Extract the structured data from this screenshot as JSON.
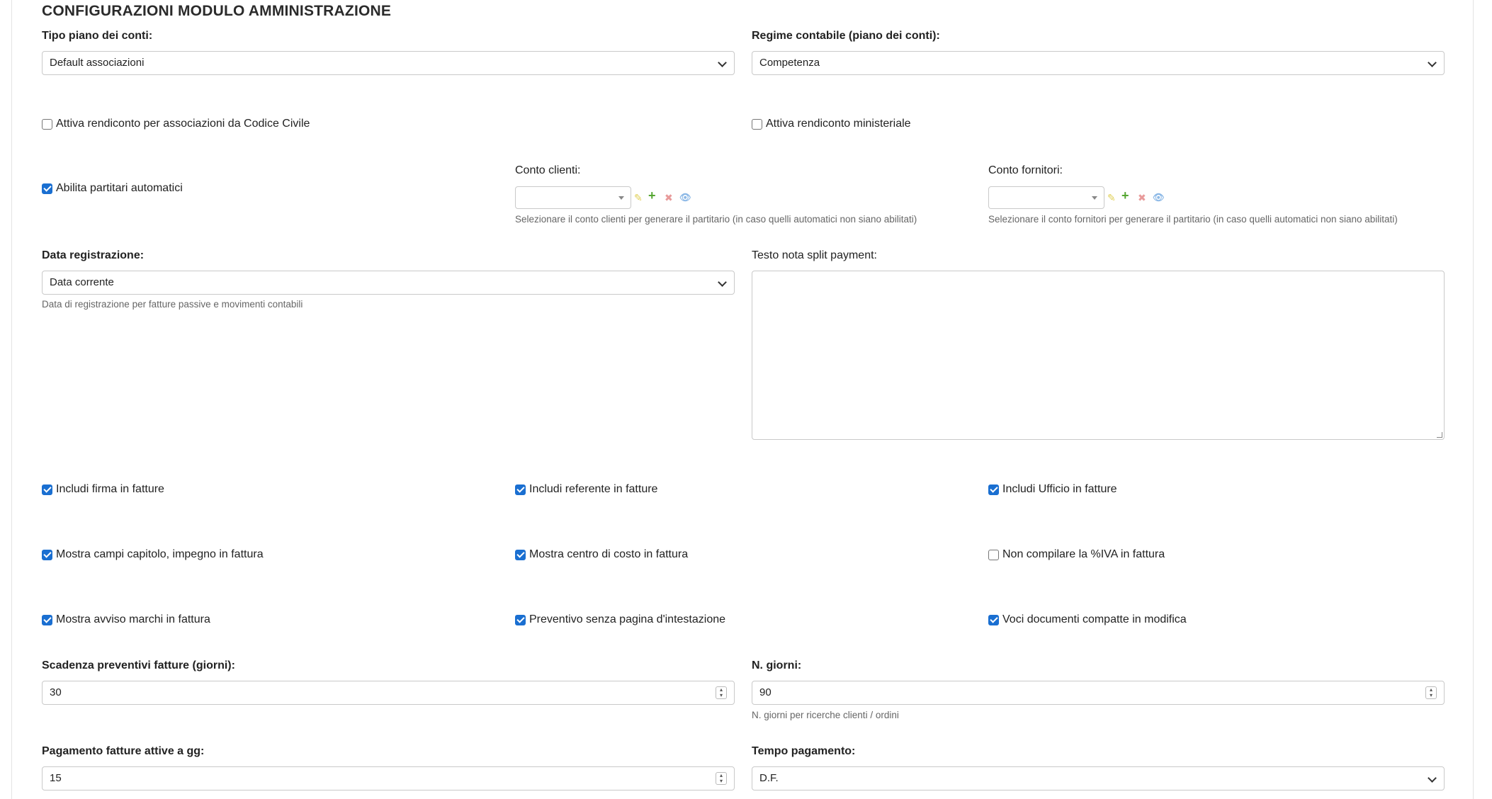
{
  "title": "CONFIGURAZIONI MODULO AMMINISTRAZIONE",
  "tipo_piano": {
    "label": "Tipo piano dei conti:",
    "value": "Default associazioni"
  },
  "regime": {
    "label": "Regime contabile (piano dei conti):",
    "value": "Competenza"
  },
  "checks_row1": [
    {
      "label": "Attiva rendiconto per associazioni da Codice Civile",
      "checked": false
    },
    {
      "label": "Attiva rendiconto ministeriale",
      "checked": false
    }
  ],
  "partitari": {
    "label": "Abilita partitari automatici",
    "checked": true
  },
  "conto_clienti": {
    "label": "Conto clienti:",
    "help": "Selezionare il conto clienti per generare il partitario (in caso quelli automatici non siano abilitati)"
  },
  "conto_fornitori": {
    "label": "Conto fornitori:",
    "help": "Selezionare il conto fornitori per generare il partitario (in caso quelli automatici non siano abilitati)"
  },
  "data_registrazione": {
    "label": "Data registrazione:",
    "value": "Data corrente",
    "help": "Data di registrazione per fatture passive e movimenti contabili"
  },
  "split_payment": {
    "label": "Testo nota split payment:",
    "value": ""
  },
  "check_grid": [
    {
      "label": "Includi firma in fatture",
      "checked": true
    },
    {
      "label": "Includi referente in fatture",
      "checked": true
    },
    {
      "label": "Includi Ufficio in fatture",
      "checked": true
    },
    {
      "label": "Mostra campi capitolo, impegno in fattura",
      "checked": true
    },
    {
      "label": "Mostra centro di costo in fattura",
      "checked": true
    },
    {
      "label": "Non compilare la %IVA in fattura",
      "checked": false
    },
    {
      "label": "Mostra avviso marchi in fattura",
      "checked": true
    },
    {
      "label": "Preventivo senza pagina d'intestazione",
      "checked": true
    },
    {
      "label": "Voci documenti compatte in modifica",
      "checked": true
    }
  ],
  "scadenza": {
    "label": "Scadenza preventivi fatture (giorni):",
    "value": "30"
  },
  "n_giorni": {
    "label": "N. giorni:",
    "value": "90",
    "help": "N. giorni per ricerche clienti / ordini"
  },
  "pagamento": {
    "label": "Pagamento fatture attive a gg:",
    "value": "15"
  },
  "tempo_pagamento": {
    "label": "Tempo pagamento:",
    "value": "D.F."
  },
  "icons": {
    "edit": "✎",
    "add": "+",
    "remove": "✖",
    "view": "👁"
  },
  "colors": {
    "accent": "#1a6fd1"
  }
}
